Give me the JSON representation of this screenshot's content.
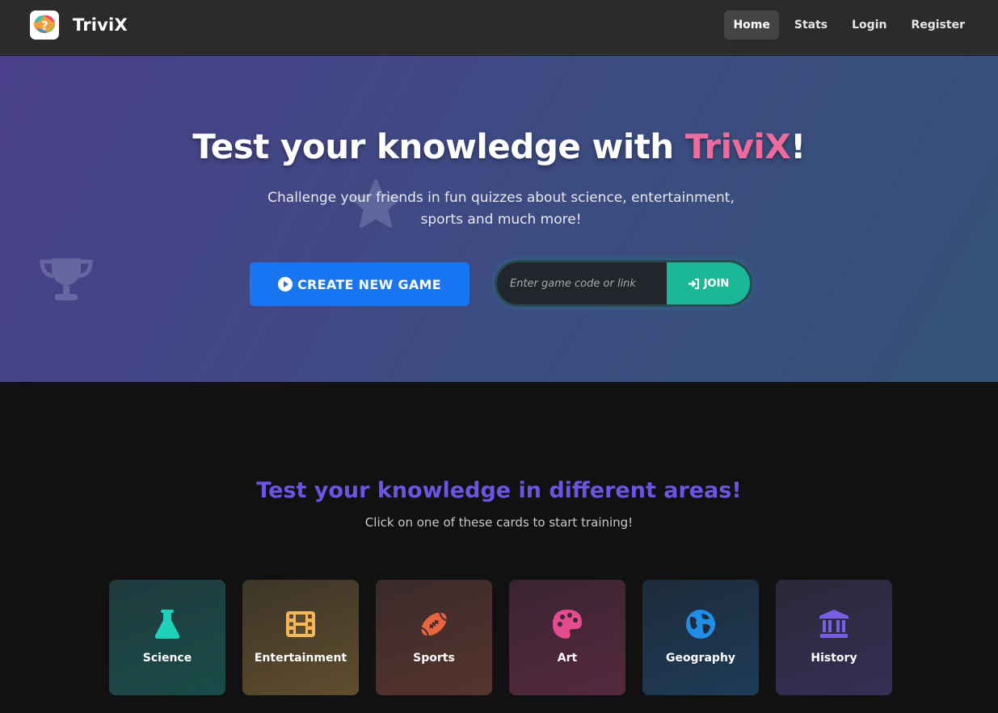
{
  "navbar": {
    "brand": "TriviX",
    "links": [
      {
        "label": "Home",
        "active": true
      },
      {
        "label": "Stats",
        "active": false
      },
      {
        "label": "Login",
        "active": false
      },
      {
        "label": "Register",
        "active": false
      }
    ]
  },
  "hero": {
    "title_prefix": "Test your knowledge with ",
    "title_accent": "TriviX",
    "title_suffix": "!",
    "subtitle": "Challenge your friends in fun quizzes about science, entertainment, sports and much more!",
    "create_button": "CREATE NEW GAME",
    "join_placeholder": "Enter game code or link",
    "join_button": "JOIN"
  },
  "section": {
    "title": "Test your knowledge in different areas!",
    "subtitle": "Click on one of these cards to start training!"
  },
  "categories": [
    {
      "label": "Science",
      "icon": "flask-icon",
      "color": "#1fd1b9"
    },
    {
      "label": "Entertainment",
      "icon": "film-icon",
      "color": "#f5b75a"
    },
    {
      "label": "Sports",
      "icon": "football-icon",
      "color": "#e8663f"
    },
    {
      "label": "Art",
      "icon": "palette-icon",
      "color": "#e64a8f"
    },
    {
      "label": "Geography",
      "icon": "globe-icon",
      "color": "#1f8fe6"
    },
    {
      "label": "History",
      "icon": "landmark-icon",
      "color": "#7a5ee8"
    }
  ],
  "colors": {
    "accent_pink": "#f06a9c",
    "primary_blue": "#1976f2",
    "join_green": "#19b896",
    "section_purple": "#6c54e6"
  }
}
